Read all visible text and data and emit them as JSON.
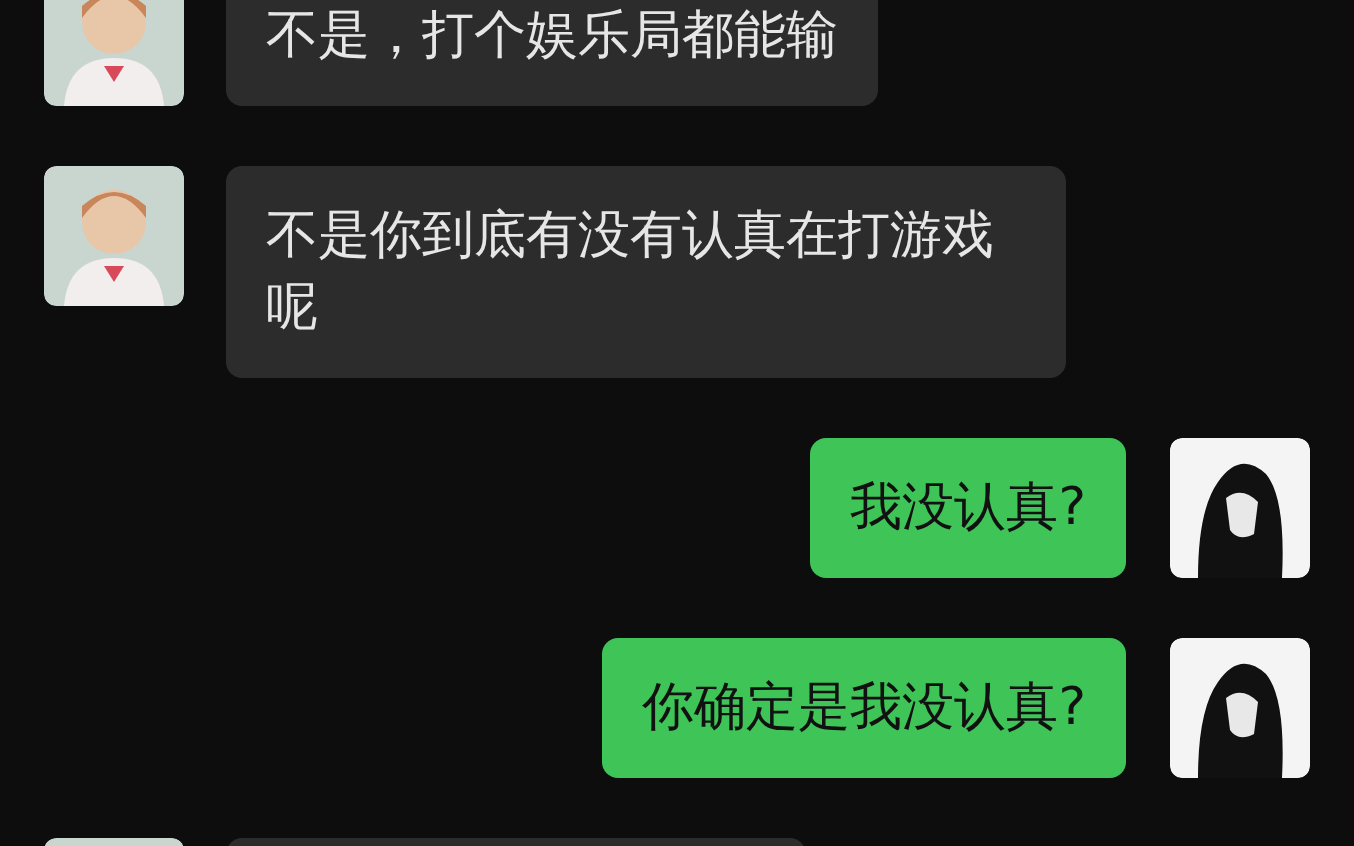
{
  "messages": [
    {
      "kind": "incoming",
      "text": "不是，打个娱乐局都能输"
    },
    {
      "kind": "incoming",
      "text": "不是你到底有没有认真在打游戏呢"
    },
    {
      "kind": "outgoing",
      "text": "我没认真?"
    },
    {
      "kind": "outgoing",
      "text": "你确定是我没认真?"
    },
    {
      "kind": "incoming"
    }
  ]
}
